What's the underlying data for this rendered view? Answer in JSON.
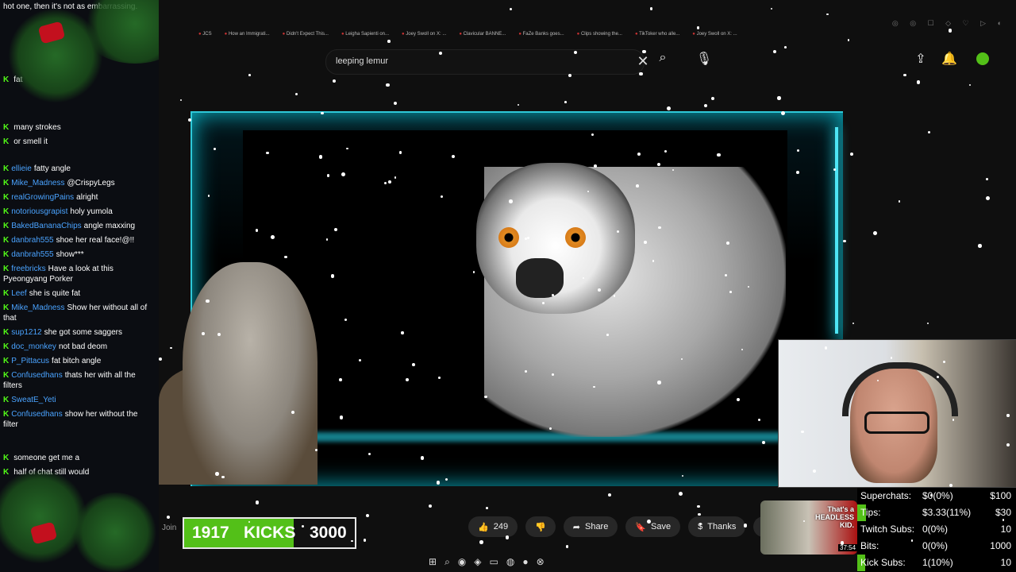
{
  "chat": {
    "caption": "hot one, then it's not as embarrassing.",
    "messages": [
      {
        "user": "",
        "text": "fat"
      },
      {
        "user": "",
        "text": "many strokes"
      },
      {
        "user": "",
        "text": "or smell it"
      },
      {
        "user": "ellieie",
        "text": "fatty angle"
      },
      {
        "user": "Mike_Madness",
        "text": "@CrispyLegs"
      },
      {
        "user": "realGrowingPains",
        "text": "alright"
      },
      {
        "user": "notoriousgrapist",
        "text": "holy yumola"
      },
      {
        "user": "BakedBananaChips",
        "text": "angle maxxing"
      },
      {
        "user": "danbrah555",
        "text": "shoe her real face!@!!"
      },
      {
        "user": "danbrah555",
        "text": "show***"
      },
      {
        "user": "freebricks",
        "text": "Have a look at this Pyeongyang Porker"
      },
      {
        "user": "Leef",
        "text": "she is quite fat"
      },
      {
        "user": "Mike_Madness",
        "text": "Show her without all of that"
      },
      {
        "user": "sup1212",
        "text": "she got some saggers"
      },
      {
        "user": "doc_monkey",
        "text": "not bad deom"
      },
      {
        "user": "P_Pittacus",
        "text": "fat bitch angle"
      },
      {
        "user": "Confusedhans",
        "text": "thats her with all the filters"
      },
      {
        "user": "SweatE_Yeti",
        "text": ""
      },
      {
        "user": "Confusedhans",
        "text": "show her without the filter"
      },
      {
        "user": "",
        "text": "someone get me a"
      },
      {
        "user": "",
        "text": "half of chat still would"
      }
    ]
  },
  "browser": {
    "tabs": [
      "JCS",
      "How an Immigrati...",
      "Didn't Expect This...",
      "Leigha Sapienti on...",
      "Joey Swoll on X: ...",
      "Clavicular BANNE...",
      "FaZe Banks goes...",
      "Clips showing the...",
      "TikToker who alle...",
      "Joey Swoll on X: ..."
    ],
    "search_value": "leeping lemur",
    "search_icon": "magnifier",
    "mic_icon": "microphone",
    "upload_icon": "upload-arrow",
    "bell_icon": "bell"
  },
  "actions": {
    "like_count": "249",
    "share": "Share",
    "save": "Save",
    "thanks": "Thanks",
    "more": "⋯"
  },
  "kicks": {
    "current": "1917",
    "label": "KICKS",
    "goal": "3000",
    "progress": 0.64,
    "join": "Join"
  },
  "thumbnail": {
    "title": "That's a HEADLESS KID.",
    "duration": "37:54"
  },
  "stats": [
    {
      "label": "Superchats:",
      "value": "$0(0%)",
      "goal": "$100",
      "progress": 0.0
    },
    {
      "label": "Tips:",
      "value": "$3.33(11%)",
      "goal": "$30",
      "progress": 0.11
    },
    {
      "label": "Twitch Subs:",
      "value": "0(0%)",
      "goal": "10",
      "progress": 0.0
    },
    {
      "label": "Bits:",
      "value": "0(0%)",
      "goal": "1000",
      "progress": 0.0
    },
    {
      "label": "Kick Subs:",
      "value": "1(10%)",
      "goal": "10",
      "progress": 0.1
    }
  ],
  "colors": {
    "kick_green": "#53c018",
    "neon": "#2ec8d8"
  }
}
